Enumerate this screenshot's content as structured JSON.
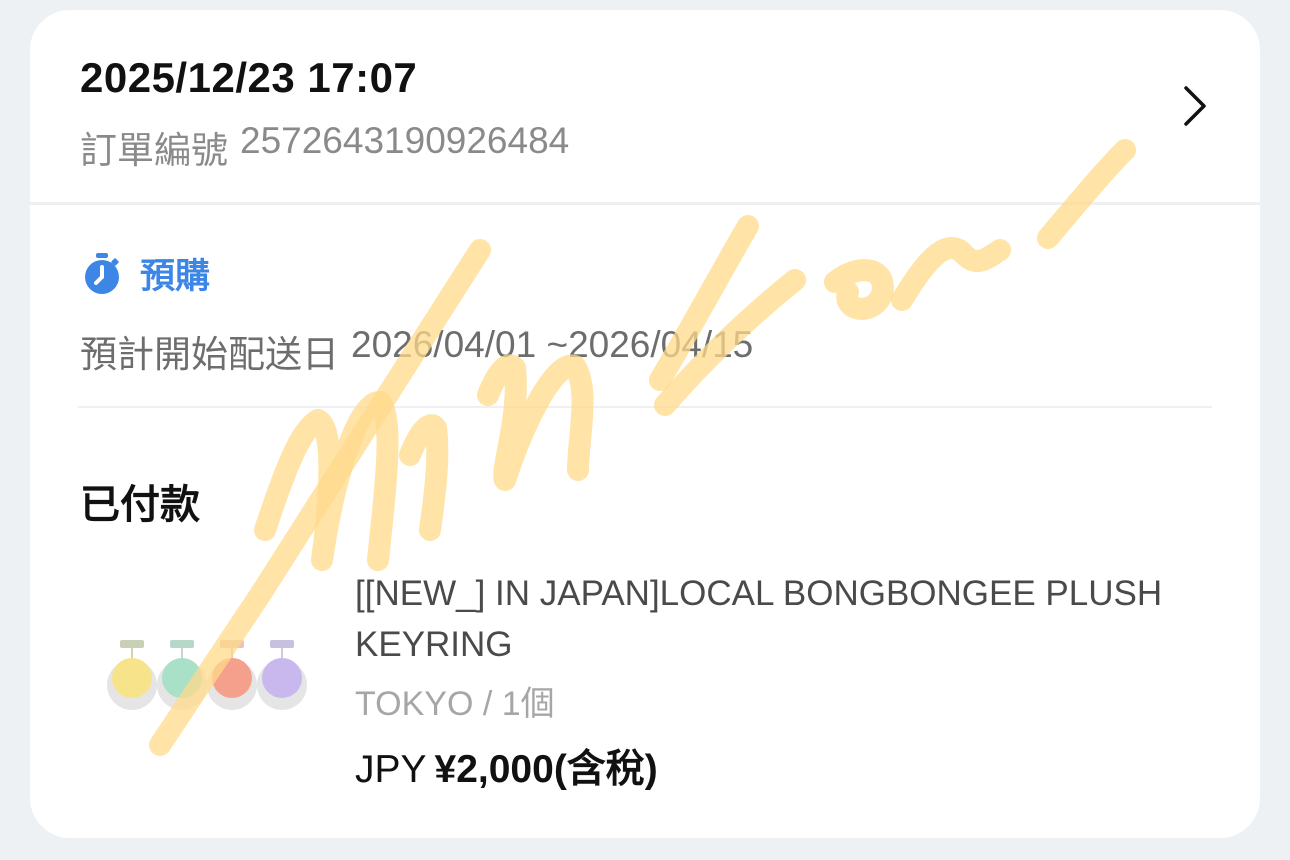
{
  "order": {
    "datetime": "2025/12/23 17:07",
    "number_label": "訂單編號",
    "number": "2572643190926484"
  },
  "preorder": {
    "label": "預購",
    "icon": "stopwatch-icon",
    "ship_label": "預計開始配送日",
    "ship_range": "2026/04/01 ~2026/04/15"
  },
  "payment": {
    "status": "已付款"
  },
  "product": {
    "title": "[[NEW_] IN JAPAN]LOCAL BONGBONGEE PLUSH KEYRING",
    "variant": "TOKYO / 1個",
    "currency": "JPY",
    "price": "¥2,000(含稅)",
    "thumb_colors": [
      "#f7e38a",
      "#a8e0c8",
      "#f4a08c",
      "#c9b8ee"
    ]
  },
  "watermark": {
    "text": "Minwon"
  },
  "colors": {
    "accent": "#3d86e6",
    "watermark": "#ffd98a"
  }
}
